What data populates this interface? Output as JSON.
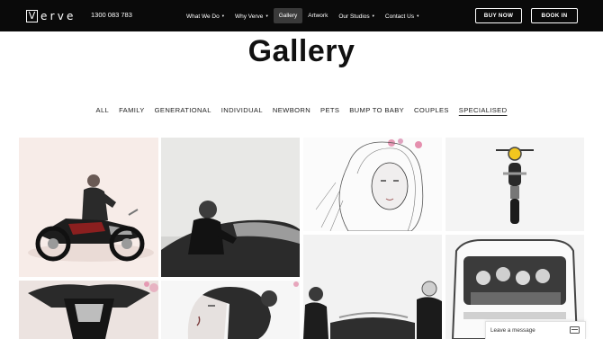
{
  "header": {
    "logo_initial": "V",
    "logo_rest": "erve",
    "phone": "1300 083 783",
    "nav": [
      {
        "label": "What We Do",
        "dropdown": true
      },
      {
        "label": "Why Verve",
        "dropdown": true
      },
      {
        "label": "Gallery",
        "dropdown": false,
        "active": true
      },
      {
        "label": "Artwork",
        "dropdown": false
      },
      {
        "label": "Our Studios",
        "dropdown": true
      },
      {
        "label": "Contact Us",
        "dropdown": true
      }
    ],
    "buy_label": "BUY NOW",
    "book_label": "BOOK IN"
  },
  "page": {
    "title": "Gallery"
  },
  "filters": [
    "ALL",
    "FAMILY",
    "GENERATIONAL",
    "INDIVIDUAL",
    "NEWBORN",
    "PETS",
    "BUMP TO BABY",
    "COUPLES",
    "SPECIALISED"
  ],
  "active_filter": "SPECIALISED",
  "gallery": [
    {
      "name": "photo-man-on-motorcycle"
    },
    {
      "name": "photo-man-in-convertible"
    },
    {
      "name": "photo-girl-sketch-portrait"
    },
    {
      "name": "photo-motorcycle-yellow-light"
    },
    {
      "name": "photo-motorcycle-front"
    },
    {
      "name": "photo-woman-profile"
    },
    {
      "name": "photo-couple-in-convertible"
    },
    {
      "name": "photo-family-in-van"
    }
  ],
  "chat": {
    "label": "Leave a message",
    "icon": "chat-window-icon"
  },
  "colors": {
    "topbar": "#0a0a0a",
    "nav_active_bg": "#3a3a3a"
  }
}
